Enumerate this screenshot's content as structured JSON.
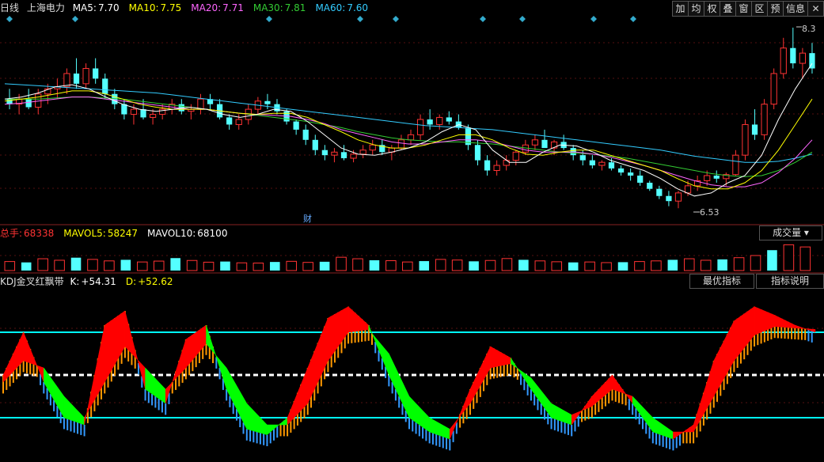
{
  "main_header": {
    "period": "日线",
    "stock": "上海电力",
    "ma_items": [
      {
        "label": "MA5:",
        "value": "7.70",
        "color": "#ffffff"
      },
      {
        "label": "MA10:",
        "value": "7.75",
        "color": "#ffff00"
      },
      {
        "label": "MA20:",
        "value": "7.71",
        "color": "#ff66ff"
      },
      {
        "label": "MA30:",
        "value": "7.81",
        "color": "#33cc33"
      },
      {
        "label": "MA60:",
        "value": "7.60",
        "color": "#33ccff"
      }
    ]
  },
  "toolbar": {
    "buttons": [
      "加",
      "均",
      "权",
      "叠",
      "窗",
      "区",
      "预",
      "信息"
    ],
    "close": "✕"
  },
  "volume_header": {
    "items": [
      {
        "label": "总手:",
        "value": "68338",
        "color": "#ff3333"
      },
      {
        "label": "MAVOL5:",
        "value": "58247",
        "color": "#ffff00"
      },
      {
        "label": "MAVOL10:",
        "value": "68100",
        "color": "#ffffff"
      }
    ],
    "dropdown": "成交量 ▾"
  },
  "kdj_header": {
    "name": "KDJ金叉红飘带",
    "items": [
      {
        "label": "K:",
        "value": "+54.31",
        "color": "#ffffff"
      },
      {
        "label": "D:",
        "value": "+52.62",
        "color": "#ffff00"
      }
    ],
    "btn_best": "最优指标",
    "btn_help": "指标说明"
  },
  "annotations": {
    "high": "8.3",
    "low": "6.53",
    "finance_marker": "财"
  },
  "colors": {
    "up": "#ff3333",
    "down": "#54ffff",
    "ma5": "#ffffff",
    "ma10": "#ffff00",
    "ma20": "#ff66ff",
    "ma30": "#33cc33",
    "ma60": "#33ccff",
    "kdj_up": "#ff0000",
    "kdj_down": "#00ff00",
    "kdj_bar_up": "#ff9900",
    "kdj_bar_down": "#3399ff",
    "level_line": "#00ffff"
  },
  "chart_data": {
    "type": "candlestick",
    "price_range": [
      6.4,
      8.4
    ],
    "volume_range": [
      0,
      140000
    ],
    "kdj_range": [
      -10,
      110
    ],
    "kdj_levels": [
      20,
      50,
      80
    ],
    "candles": [
      [
        7.6,
        7.7,
        7.5,
        7.55
      ],
      [
        7.55,
        7.65,
        7.45,
        7.6
      ],
      [
        7.6,
        7.7,
        7.5,
        7.52
      ],
      [
        7.52,
        7.7,
        7.45,
        7.65
      ],
      [
        7.65,
        7.75,
        7.55,
        7.7
      ],
      [
        7.7,
        7.8,
        7.6,
        7.72
      ],
      [
        7.72,
        7.9,
        7.65,
        7.85
      ],
      [
        7.85,
        8.0,
        7.7,
        7.75
      ],
      [
        7.75,
        7.95,
        7.7,
        7.9
      ],
      [
        7.9,
        8.0,
        7.75,
        7.8
      ],
      [
        7.8,
        7.85,
        7.6,
        7.65
      ],
      [
        7.65,
        7.7,
        7.5,
        7.55
      ],
      [
        7.55,
        7.6,
        7.4,
        7.45
      ],
      [
        7.45,
        7.55,
        7.35,
        7.5
      ],
      [
        7.5,
        7.6,
        7.4,
        7.42
      ],
      [
        7.42,
        7.5,
        7.35,
        7.45
      ],
      [
        7.45,
        7.55,
        7.4,
        7.5
      ],
      [
        7.5,
        7.6,
        7.45,
        7.55
      ],
      [
        7.55,
        7.6,
        7.45,
        7.48
      ],
      [
        7.48,
        7.55,
        7.4,
        7.5
      ],
      [
        7.5,
        7.65,
        7.45,
        7.6
      ],
      [
        7.6,
        7.65,
        7.5,
        7.55
      ],
      [
        7.55,
        7.6,
        7.4,
        7.42
      ],
      [
        7.42,
        7.45,
        7.3,
        7.35
      ],
      [
        7.35,
        7.45,
        7.3,
        7.4
      ],
      [
        7.4,
        7.55,
        7.35,
        7.5
      ],
      [
        7.5,
        7.62,
        7.45,
        7.58
      ],
      [
        7.58,
        7.65,
        7.5,
        7.55
      ],
      [
        7.55,
        7.6,
        7.45,
        7.48
      ],
      [
        7.48,
        7.5,
        7.35,
        7.38
      ],
      [
        7.38,
        7.4,
        7.25,
        7.3
      ],
      [
        7.3,
        7.35,
        7.15,
        7.2
      ],
      [
        7.2,
        7.25,
        7.05,
        7.1
      ],
      [
        7.1,
        7.15,
        7.0,
        7.05
      ],
      [
        7.05,
        7.12,
        6.98,
        7.08
      ],
      [
        7.08,
        7.15,
        7.0,
        7.02
      ],
      [
        7.02,
        7.1,
        6.98,
        7.06
      ],
      [
        7.06,
        7.15,
        7.02,
        7.1
      ],
      [
        7.1,
        7.2,
        7.05,
        7.15
      ],
      [
        7.15,
        7.2,
        7.05,
        7.08
      ],
      [
        7.08,
        7.15,
        7.0,
        7.12
      ],
      [
        7.12,
        7.25,
        7.1,
        7.2
      ],
      [
        7.2,
        7.3,
        7.15,
        7.25
      ],
      [
        7.25,
        7.45,
        7.2,
        7.4
      ],
      [
        7.4,
        7.5,
        7.3,
        7.35
      ],
      [
        7.35,
        7.45,
        7.3,
        7.42
      ],
      [
        7.42,
        7.48,
        7.35,
        7.38
      ],
      [
        7.38,
        7.45,
        7.3,
        7.32
      ],
      [
        7.32,
        7.35,
        7.1,
        7.15
      ],
      [
        7.15,
        7.2,
        6.95,
        7.0
      ],
      [
        7.0,
        7.05,
        6.85,
        6.9
      ],
      [
        6.9,
        7.0,
        6.85,
        6.95
      ],
      [
        6.95,
        7.05,
        6.9,
        7.0
      ],
      [
        7.0,
        7.1,
        6.95,
        7.08
      ],
      [
        7.08,
        7.2,
        7.05,
        7.15
      ],
      [
        7.15,
        7.25,
        7.1,
        7.2
      ],
      [
        7.2,
        7.3,
        7.15,
        7.12
      ],
      [
        7.12,
        7.2,
        7.05,
        7.18
      ],
      [
        7.18,
        7.25,
        7.1,
        7.12
      ],
      [
        7.12,
        7.15,
        7.0,
        7.05
      ],
      [
        7.05,
        7.1,
        6.95,
        7.0
      ],
      [
        7.0,
        7.05,
        6.92,
        6.95
      ],
      [
        6.95,
        7.0,
        6.9,
        6.98
      ],
      [
        6.98,
        7.02,
        6.9,
        6.92
      ],
      [
        6.92,
        6.95,
        6.85,
        6.88
      ],
      [
        6.88,
        6.92,
        6.8,
        6.85
      ],
      [
        6.85,
        6.9,
        6.75,
        6.78
      ],
      [
        6.78,
        6.8,
        6.7,
        6.72
      ],
      [
        6.72,
        6.75,
        6.62,
        6.65
      ],
      [
        6.65,
        6.7,
        6.55,
        6.6
      ],
      [
        6.6,
        6.7,
        6.53,
        6.68
      ],
      [
        6.68,
        6.8,
        6.65,
        6.75
      ],
      [
        6.75,
        6.85,
        6.7,
        6.8
      ],
      [
        6.8,
        6.9,
        6.75,
        6.85
      ],
      [
        6.85,
        6.9,
        6.78,
        6.82
      ],
      [
        6.82,
        6.88,
        6.75,
        6.86
      ],
      [
        6.86,
        7.1,
        6.85,
        7.05
      ],
      [
        7.05,
        7.4,
        7.0,
        7.35
      ],
      [
        7.35,
        7.5,
        7.2,
        7.25
      ],
      [
        7.25,
        7.6,
        7.2,
        7.55
      ],
      [
        7.55,
        7.9,
        7.5,
        7.85
      ],
      [
        7.85,
        8.2,
        7.8,
        8.1
      ],
      [
        8.1,
        8.3,
        7.9,
        7.95
      ],
      [
        7.95,
        8.1,
        7.8,
        8.05
      ],
      [
        8.05,
        8.15,
        7.85,
        7.9
      ]
    ],
    "ma5": [
      7.6,
      7.62,
      7.66,
      7.72,
      7.74,
      7.7,
      7.62,
      7.55,
      7.5,
      7.48,
      7.5,
      7.52,
      7.5,
      7.45,
      7.42,
      7.45,
      7.5,
      7.48,
      7.38,
      7.25,
      7.12,
      7.06,
      7.05,
      7.08,
      7.12,
      7.18,
      7.28,
      7.35,
      7.3,
      7.1,
      6.98,
      6.98,
      7.08,
      7.15,
      7.14,
      7.08,
      7.0,
      6.95,
      6.9,
      6.82,
      6.72,
      6.65,
      6.68,
      6.78,
      6.85,
      7.05,
      7.4,
      7.7,
      7.95
    ],
    "ma10": [
      7.58,
      7.6,
      7.62,
      7.65,
      7.68,
      7.68,
      7.65,
      7.6,
      7.55,
      7.52,
      7.5,
      7.5,
      7.5,
      7.48,
      7.46,
      7.45,
      7.46,
      7.46,
      7.42,
      7.35,
      7.28,
      7.2,
      7.15,
      7.12,
      7.12,
      7.15,
      7.2,
      7.25,
      7.25,
      7.2,
      7.12,
      7.06,
      7.05,
      7.08,
      7.1,
      7.1,
      7.05,
      7.0,
      6.95,
      6.9,
      6.82,
      6.75,
      6.72,
      6.72,
      6.78,
      6.9,
      7.1,
      7.35,
      7.6
    ],
    "ma20": [
      7.55,
      7.56,
      7.58,
      7.6,
      7.62,
      7.62,
      7.6,
      7.58,
      7.56,
      7.54,
      7.52,
      7.5,
      7.5,
      7.48,
      7.46,
      7.45,
      7.44,
      7.43,
      7.4,
      7.36,
      7.3,
      7.26,
      7.22,
      7.18,
      7.16,
      7.16,
      7.18,
      7.2,
      7.2,
      7.18,
      7.14,
      7.1,
      7.08,
      7.08,
      7.08,
      7.06,
      7.03,
      6.99,
      6.95,
      6.9,
      6.85,
      6.8,
      6.76,
      6.74,
      6.74,
      6.78,
      6.88,
      7.02,
      7.2
    ],
    "ma30": [
      7.6,
      7.6,
      7.6,
      7.61,
      7.62,
      7.62,
      7.61,
      7.6,
      7.58,
      7.56,
      7.54,
      7.52,
      7.5,
      7.48,
      7.46,
      7.44,
      7.42,
      7.4,
      7.38,
      7.35,
      7.32,
      7.28,
      7.25,
      7.22,
      7.2,
      7.19,
      7.18,
      7.18,
      7.17,
      7.16,
      7.14,
      7.12,
      7.1,
      7.08,
      7.07,
      7.06,
      7.04,
      7.02,
      6.99,
      6.96,
      6.93,
      6.9,
      6.87,
      6.85,
      6.84,
      6.85,
      6.9,
      6.98,
      7.08
    ],
    "ma60": [
      7.75,
      7.74,
      7.73,
      7.72,
      7.71,
      7.7,
      7.69,
      7.68,
      7.67,
      7.66,
      7.64,
      7.62,
      7.6,
      7.58,
      7.56,
      7.54,
      7.52,
      7.5,
      7.48,
      7.46,
      7.44,
      7.42,
      7.4,
      7.38,
      7.36,
      7.34,
      7.33,
      7.32,
      7.31,
      7.3,
      7.28,
      7.26,
      7.24,
      7.22,
      7.2,
      7.18,
      7.16,
      7.14,
      7.12,
      7.1,
      7.07,
      7.04,
      7.02,
      7.0,
      6.98,
      6.98,
      6.99,
      7.02,
      7.06
    ],
    "volume": [
      42000,
      38000,
      55000,
      48000,
      60000,
      52000,
      45000,
      50000,
      40000,
      44000,
      58000,
      47000,
      39000,
      42000,
      36000,
      35000,
      40000,
      43000,
      38000,
      41000,
      62000,
      55000,
      48000,
      46000,
      40000,
      44000,
      52000,
      49000,
      43000,
      47000,
      56000,
      50000,
      45000,
      41000,
      38000,
      40000,
      37000,
      39000,
      42000,
      45000,
      50000,
      55000,
      48000,
      52000,
      60000,
      70000,
      95000,
      120000,
      110000
    ],
    "kdj": [
      {
        "k": 50,
        "d": 45
      },
      {
        "k": 80,
        "d": 60
      },
      {
        "k": 45,
        "d": 55
      },
      {
        "k": 20,
        "d": 35
      },
      {
        "k": 15,
        "d": 20
      },
      {
        "k": 85,
        "d": 45
      },
      {
        "k": 95,
        "d": 70
      },
      {
        "k": 40,
        "d": 55
      },
      {
        "k": 30,
        "d": 40
      },
      {
        "k": 75,
        "d": 55
      },
      {
        "k": 85,
        "d": 72
      },
      {
        "k": 40,
        "d": 55
      },
      {
        "k": 12,
        "d": 30
      },
      {
        "k": 8,
        "d": 15
      },
      {
        "k": 20,
        "d": 15
      },
      {
        "k": 55,
        "d": 30
      },
      {
        "k": 90,
        "d": 60
      },
      {
        "k": 98,
        "d": 80
      },
      {
        "k": 85,
        "d": 82
      },
      {
        "k": 50,
        "d": 65
      },
      {
        "k": 20,
        "d": 35
      },
      {
        "k": 10,
        "d": 20
      },
      {
        "k": 5,
        "d": 12
      },
      {
        "k": 40,
        "d": 30
      },
      {
        "k": 70,
        "d": 55
      },
      {
        "k": 62,
        "d": 58
      },
      {
        "k": 40,
        "d": 48
      },
      {
        "k": 20,
        "d": 30
      },
      {
        "k": 15,
        "d": 22
      },
      {
        "k": 35,
        "d": 28
      },
      {
        "k": 50,
        "d": 40
      },
      {
        "k": 30,
        "d": 35
      },
      {
        "k": 10,
        "d": 20
      },
      {
        "k": 5,
        "d": 10
      },
      {
        "k": 15,
        "d": 10
      },
      {
        "k": 60,
        "d": 35
      },
      {
        "k": 88,
        "d": 60
      },
      {
        "k": 98,
        "d": 78
      },
      {
        "k": 92,
        "d": 84
      },
      {
        "k": 85,
        "d": 83
      },
      {
        "k": 80,
        "d": 82
      }
    ],
    "xlabel": "",
    "ylabel": ""
  }
}
